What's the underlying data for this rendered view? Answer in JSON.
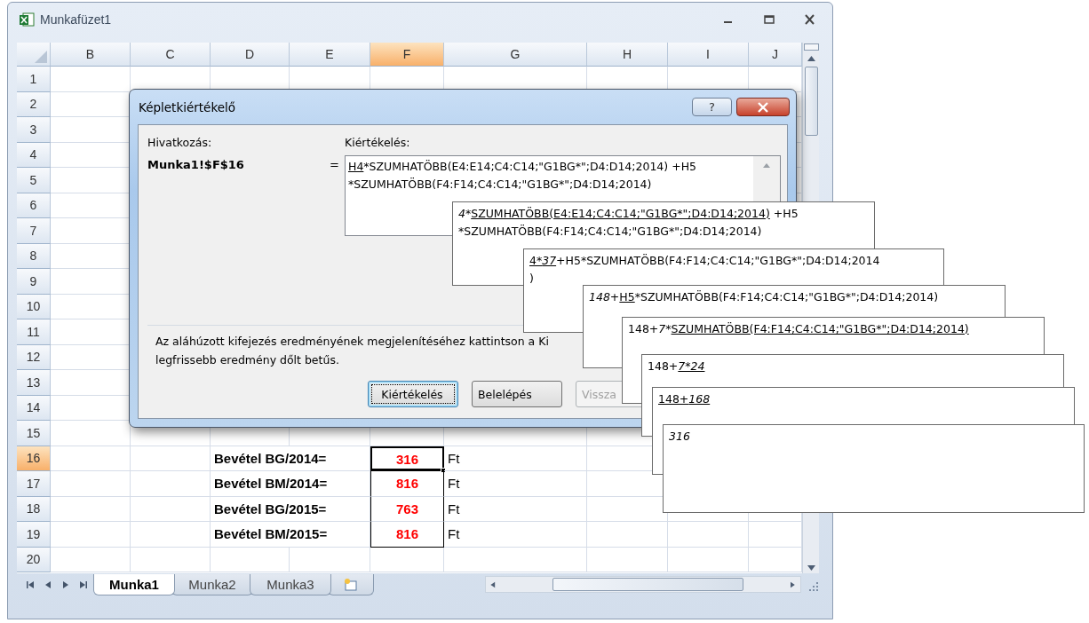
{
  "window": {
    "title": "Munkafüzet1"
  },
  "columns": [
    {
      "label": "B",
      "selected": false
    },
    {
      "label": "C",
      "selected": false
    },
    {
      "label": "D",
      "selected": false
    },
    {
      "label": "E",
      "selected": false
    },
    {
      "label": "F",
      "selected": true
    },
    {
      "label": "G",
      "selected": false
    },
    {
      "label": "H",
      "selected": false
    },
    {
      "label": "I",
      "selected": false
    },
    {
      "label": "J",
      "selected": false
    }
  ],
  "rows": [
    {
      "label": "1",
      "selected": false
    },
    {
      "label": "2",
      "selected": false
    },
    {
      "label": "3",
      "selected": false
    },
    {
      "label": "4",
      "selected": false
    },
    {
      "label": "5",
      "selected": false
    },
    {
      "label": "6",
      "selected": false
    },
    {
      "label": "7",
      "selected": false
    },
    {
      "label": "8",
      "selected": false
    },
    {
      "label": "9",
      "selected": false
    },
    {
      "label": "10",
      "selected": false
    },
    {
      "label": "11",
      "selected": false
    },
    {
      "label": "12",
      "selected": false
    },
    {
      "label": "13",
      "selected": false
    },
    {
      "label": "14",
      "selected": false
    },
    {
      "label": "15",
      "selected": false
    },
    {
      "label": "16",
      "selected": true,
      "caption": "Bevétel BG/2014=",
      "value": "316",
      "unit": "Ft",
      "value_selected": true
    },
    {
      "label": "17",
      "selected": false,
      "caption": "Bevétel BM/2014=",
      "value": "816",
      "unit": "Ft",
      "value_selected": false
    },
    {
      "label": "18",
      "selected": false,
      "caption": "Bevétel BG/2015=",
      "value": "763",
      "unit": "Ft",
      "value_selected": false
    },
    {
      "label": "19",
      "selected": false,
      "caption": "Bevétel BM/2015=",
      "value": "816",
      "unit": "Ft",
      "value_selected": false
    },
    {
      "label": "20",
      "selected": false
    }
  ],
  "sheet_tabs": [
    {
      "label": "Munka1",
      "selected": true
    },
    {
      "label": "Munka2",
      "selected": false
    },
    {
      "label": "Munka3",
      "selected": false
    }
  ],
  "dialog": {
    "title": "Képletkiértékelő",
    "help": "?",
    "reference_label": "Hivatkozás:",
    "reference": "Munka1!$F$16",
    "equals": "=",
    "evaluation_label": "Kiértékelés:",
    "formula": [
      [
        {
          "text": "H4",
          "kind": "underlined"
        },
        {
          "text": "*SZUMHATÖBB(E4:E14;C4:C14;\"G1BG*\";D4:D14;2014) +H5",
          "kind": "plain"
        }
      ],
      [
        {
          "text": "*SZUMHATÖBB(F4:F14;C4:C14;\"G1BG*\";D4:D14;2014)",
          "kind": "plain"
        }
      ]
    ],
    "info": [
      "Az aláhúzott kifejezés eredményének megjelenítéséhez kattintson a Ki",
      "legfrissebb eredmény dőlt betűs."
    ],
    "buttons": [
      {
        "label": "Kiértékelés",
        "focused": true,
        "disabled": false
      },
      {
        "label": "Belelépés",
        "focused": false,
        "disabled": false
      },
      {
        "label": "Vissza",
        "focused": false,
        "disabled": true
      }
    ]
  },
  "evaluation_steps": [
    {
      "lines": [
        [
          {
            "text": "4",
            "kind": "italic"
          },
          {
            "text": "*",
            "kind": "plain"
          },
          {
            "text": "SZUMHATÖBB(E4:E14;C4:C14;\"G1BG*\";D4:D14;2014)",
            "kind": "underlined"
          },
          {
            "text": " +H5",
            "kind": "plain"
          }
        ],
        [
          {
            "text": "*SZUMHATÖBB(F4:F14;C4:C14;\"G1BG*\";D4:D14;2014)",
            "kind": "plain"
          }
        ]
      ]
    },
    {
      "lines": [
        [
          {
            "text": "4*",
            "kind": "underlined"
          },
          {
            "text": "37",
            "kind": "underlined_italic"
          },
          {
            "text": "+H5*SZUMHATÖBB(F4:F14;C4:C14;\"G1BG*\";D4:D14;2014",
            "kind": "plain"
          }
        ],
        [
          {
            "text": ")",
            "kind": "plain"
          }
        ]
      ]
    },
    {
      "lines": [
        [
          {
            "text": "148",
            "kind": "italic"
          },
          {
            "text": "+",
            "kind": "plain"
          },
          {
            "text": "H5",
            "kind": "underlined"
          },
          {
            "text": "*SZUMHATÖBB(F4:F14;C4:C14;\"G1BG*\";D4:D14;2014)",
            "kind": "plain"
          }
        ]
      ]
    },
    {
      "lines": [
        [
          {
            "text": "148+",
            "kind": "plain"
          },
          {
            "text": "7",
            "kind": "italic"
          },
          {
            "text": "*",
            "kind": "plain"
          },
          {
            "text": "SZUMHATÖBB(F4:F14;C4:C14;\"G1BG*\";D4:D14;2014)",
            "kind": "underlined"
          }
        ]
      ]
    },
    {
      "lines": [
        [
          {
            "text": "148+",
            "kind": "plain"
          },
          {
            "text": "7*24",
            "kind": "underlined_italic"
          }
        ]
      ]
    },
    {
      "lines": [
        [
          {
            "text": "148+",
            "kind": "underlined"
          },
          {
            "text": "168",
            "kind": "underlined_italic"
          }
        ]
      ]
    },
    {
      "lines": [
        [
          {
            "text": "316",
            "kind": "italic"
          }
        ]
      ]
    }
  ]
}
